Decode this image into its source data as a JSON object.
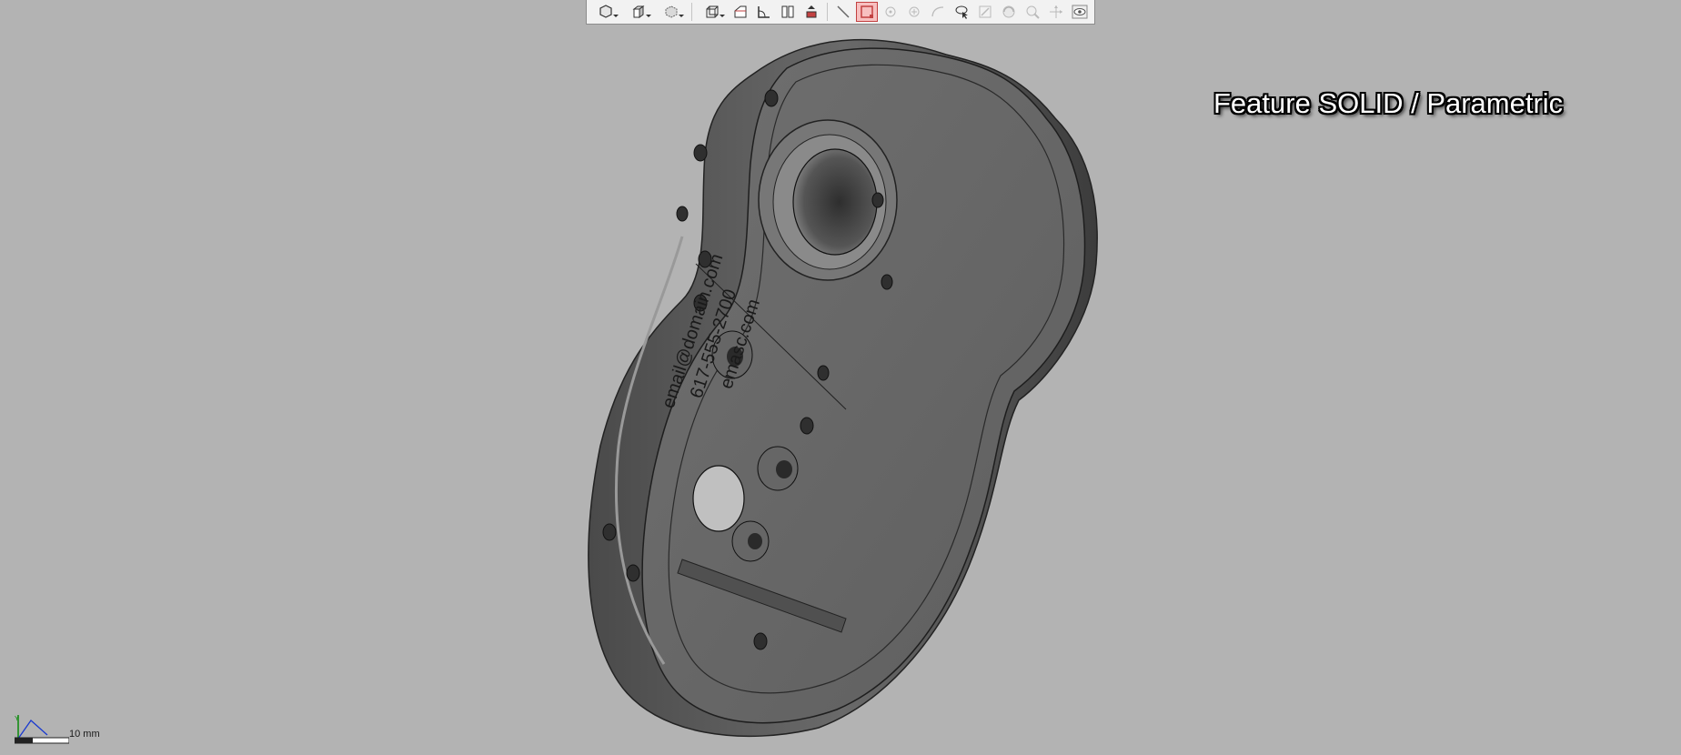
{
  "viewport": {
    "background": "#b3b3b3",
    "overlay_label": "Feature SOLID / Parametric",
    "scale_label": "10 mm",
    "part_text": {
      "line1": "email@domain.com",
      "line2": "617-555-2700",
      "line3": "emasc.com"
    }
  },
  "toolbar": {
    "active_color": "#c24141",
    "items": [
      {
        "icon": "solid-shape-icon",
        "dropdown": true
      },
      {
        "icon": "cube-view-icon",
        "dropdown": true
      },
      {
        "icon": "display-style-icon",
        "dropdown": true
      },
      {
        "icon": "wireframe-box-icon",
        "dropdown": true
      },
      {
        "icon": "section-view-icon"
      },
      {
        "icon": "measure-angle-icon"
      },
      {
        "icon": "split-view-icon"
      },
      {
        "icon": "explode-view-icon"
      },
      {
        "icon": "line-tool-icon"
      },
      {
        "icon": "select-box-icon",
        "active": true
      },
      {
        "icon": "point-tool-icon"
      },
      {
        "icon": "center-point-icon"
      },
      {
        "icon": "arc-tool-icon"
      },
      {
        "icon": "lasso-select-icon"
      },
      {
        "icon": "edit-feature-icon"
      },
      {
        "icon": "rotate-view-icon"
      },
      {
        "icon": "zoom-view-icon"
      },
      {
        "icon": "pan-view-icon"
      },
      {
        "icon": "eye-visibility-icon"
      }
    ]
  }
}
